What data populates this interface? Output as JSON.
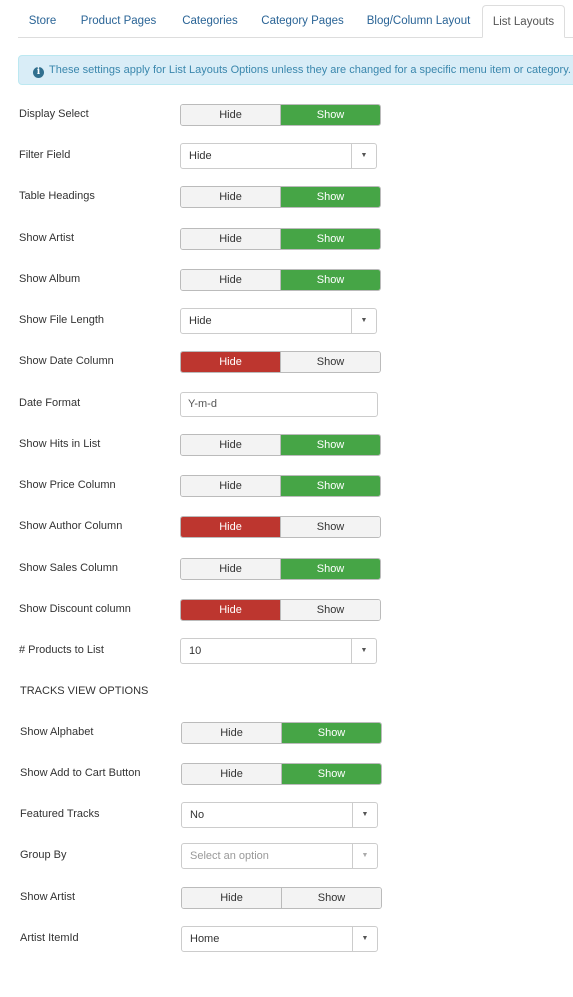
{
  "tabs": [
    {
      "label": "Store"
    },
    {
      "label": "Product Pages"
    },
    {
      "label": "Categories"
    },
    {
      "label": "Category Pages"
    },
    {
      "label": "Blog/Column Layout"
    },
    {
      "label": "List Layouts",
      "active": true
    }
  ],
  "alert": {
    "icon": "info-circle-icon",
    "text": "These settings apply for List Layouts Options unless they are changed for a specific menu item or category."
  },
  "colors": {
    "show_active": "#46a546",
    "hide_active": "#bd362f",
    "alert_bg": "#d9edf7",
    "link": "#2a6496"
  },
  "section1": [
    {
      "label": "Display Select",
      "type": "toggle",
      "value": "Show"
    },
    {
      "label": "Filter Field",
      "type": "select",
      "value": "Hide"
    },
    {
      "label": "Table Headings",
      "type": "toggle",
      "value": "Show"
    },
    {
      "label": "Show Artist",
      "type": "toggle",
      "value": "Show"
    },
    {
      "label": "Show Album",
      "type": "toggle",
      "value": "Show"
    },
    {
      "label": "Show File Length",
      "type": "select",
      "value": "Hide"
    },
    {
      "label": "Show Date Column",
      "type": "toggle",
      "value": "Hide"
    },
    {
      "label": "Date Format",
      "type": "input",
      "value": "Y-m-d"
    },
    {
      "label": "Show Hits in List",
      "type": "toggle",
      "value": "Show"
    },
    {
      "label": "Show Price Column",
      "type": "toggle",
      "value": "Show"
    },
    {
      "label": "Show Author Column",
      "type": "toggle",
      "value": "Hide"
    },
    {
      "label": "Show Sales Column",
      "type": "toggle",
      "value": "Show"
    },
    {
      "label": "Show Discount column",
      "type": "toggle",
      "value": "Hide"
    },
    {
      "label": "# Products to List",
      "type": "select",
      "value": "10"
    }
  ],
  "section2_title": "TRACKS VIEW OPTIONS",
  "section2": [
    {
      "label": "Show Alphabet",
      "type": "toggle",
      "value": "Show"
    },
    {
      "label": "Show Add to Cart Button",
      "type": "toggle",
      "value": "Show"
    },
    {
      "label": "Featured Tracks",
      "type": "select",
      "value": "No"
    },
    {
      "label": "Group By",
      "type": "select",
      "placeholder": "Select an option"
    },
    {
      "label": "Show Artist",
      "type": "toggle",
      "value": ""
    },
    {
      "label": "Artist ItemId",
      "type": "select",
      "value": "Home"
    }
  ],
  "toggle_labels": {
    "hide": "Hide",
    "show": "Show"
  }
}
